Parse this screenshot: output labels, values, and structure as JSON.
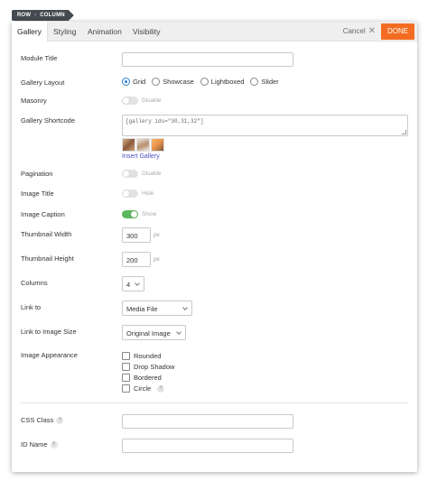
{
  "breadcrumb": {
    "row": "ROW",
    "column": "COLUMN"
  },
  "tabs": [
    {
      "label": "Gallery",
      "active": true
    },
    {
      "label": "Styling",
      "active": false
    },
    {
      "label": "Animation",
      "active": false
    },
    {
      "label": "Visibility",
      "active": false
    }
  ],
  "header": {
    "cancel_label": "Cancel",
    "cancel_icon": "close-icon",
    "done_label": "DONE",
    "done_color": "#f26c22"
  },
  "fields": {
    "module_title": {
      "label": "Module Title",
      "value": ""
    },
    "gallery_layout": {
      "label": "Gallery Layout",
      "options": [
        "Grid",
        "Showcase",
        "Lightboxed",
        "Slider"
      ],
      "selected": "Grid"
    },
    "masonry": {
      "label": "Masonry",
      "toggle_label": "Disable",
      "on": false
    },
    "gallery_shortcode": {
      "label": "Gallery Shortcode",
      "value": "[gallery ids=\"30,31,32\"]",
      "insert_label": "Insert Gallery"
    },
    "pagination": {
      "label": "Pagination",
      "toggle_label": "Disable",
      "on": false
    },
    "image_title": {
      "label": "Image Title",
      "toggle_label": "Hide",
      "on": false
    },
    "image_caption": {
      "label": "Image Caption",
      "toggle_label": "Show",
      "on": true
    },
    "thumbnail_width": {
      "label": "Thumbnail Width",
      "value": "300",
      "unit": "px"
    },
    "thumbnail_height": {
      "label": "Thumbnail Height",
      "value": "200",
      "unit": "px"
    },
    "columns": {
      "label": "Columns",
      "value": "4"
    },
    "link_to": {
      "label": "Link to",
      "value": "Media File"
    },
    "link_to_image_size": {
      "label": "Link to Image Size",
      "value": "Original Image"
    },
    "image_appearance": {
      "label": "Image Appearance",
      "options": [
        "Rounded",
        "Drop Shadow",
        "Bordered",
        "Circle"
      ]
    },
    "css_class": {
      "label": "CSS Class",
      "value": ""
    },
    "id_name": {
      "label": "ID Name",
      "value": ""
    }
  },
  "colors": {
    "accent": "#2a7fd4",
    "toggle_on": "#5cb85c",
    "link": "#4a4fc4"
  }
}
